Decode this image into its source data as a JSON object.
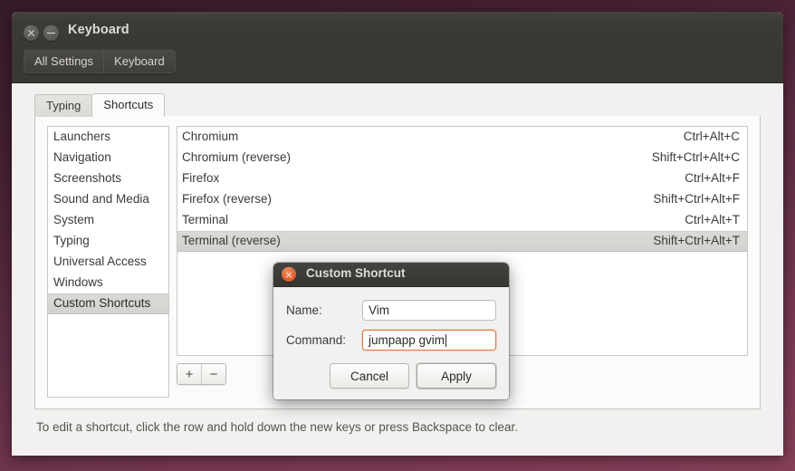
{
  "window": {
    "title": "Keyboard",
    "close_icon": "close-icon",
    "minimize_icon": "minimize-icon"
  },
  "toolbar": {
    "buttons": [
      {
        "label": "All Settings"
      },
      {
        "label": "Keyboard"
      }
    ]
  },
  "tabs": [
    {
      "label": "Typing",
      "active": false
    },
    {
      "label": "Shortcuts",
      "active": true
    }
  ],
  "categories": [
    {
      "label": "Launchers",
      "selected": false
    },
    {
      "label": "Navigation",
      "selected": false
    },
    {
      "label": "Screenshots",
      "selected": false
    },
    {
      "label": "Sound and Media",
      "selected": false
    },
    {
      "label": "System",
      "selected": false
    },
    {
      "label": "Typing",
      "selected": false
    },
    {
      "label": "Universal Access",
      "selected": false
    },
    {
      "label": "Windows",
      "selected": false
    },
    {
      "label": "Custom Shortcuts",
      "selected": true
    }
  ],
  "shortcuts": [
    {
      "name": "Chromium",
      "accel": "Ctrl+Alt+C",
      "selected": false
    },
    {
      "name": "Chromium (reverse)",
      "accel": "Shift+Ctrl+Alt+C",
      "selected": false
    },
    {
      "name": "Firefox",
      "accel": "Ctrl+Alt+F",
      "selected": false
    },
    {
      "name": "Firefox (reverse)",
      "accel": "Shift+Ctrl+Alt+F",
      "selected": false
    },
    {
      "name": "Terminal",
      "accel": "Ctrl+Alt+T",
      "selected": false
    },
    {
      "name": "Terminal (reverse)",
      "accel": "Shift+Ctrl+Alt+T",
      "selected": true
    }
  ],
  "list_toolbar": {
    "add_label": "+",
    "remove_label": "−"
  },
  "hint": "To edit a shortcut, click the row and hold down the new keys or press Backspace to clear.",
  "dialog": {
    "title": "Custom Shortcut",
    "close_icon": "close-icon",
    "name_label": "Name:",
    "name_value": "Vim",
    "command_label": "Command:",
    "command_value": "jumpapp gvim",
    "cancel_label": "Cancel",
    "apply_label": "Apply"
  },
  "colors": {
    "desktop_top": "#361a28",
    "desktop_bottom": "#863f59",
    "titlebar": "#3c3a36",
    "focus_accent": "#e07b44",
    "dialog_close": "#e0602f",
    "selection": "#d8d6d2"
  }
}
